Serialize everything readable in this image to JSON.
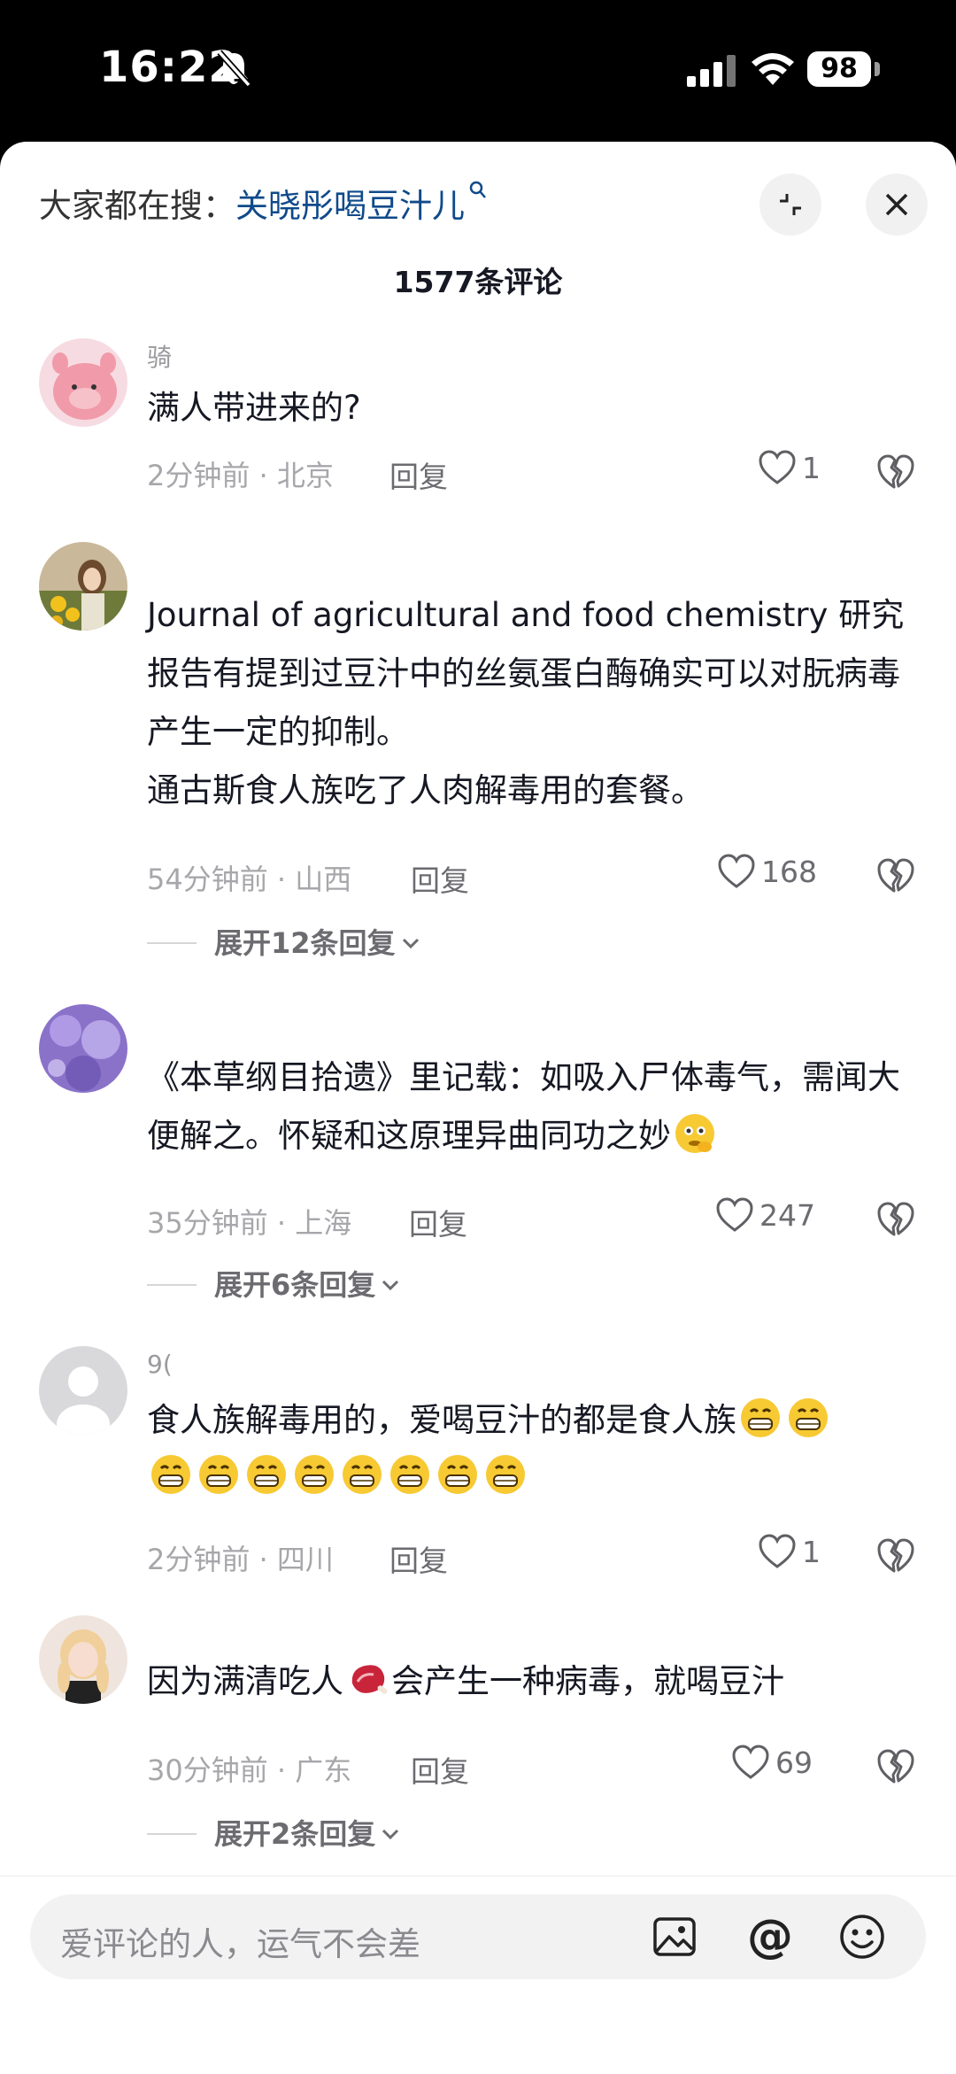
{
  "status": {
    "time": "16:22",
    "battery": "98"
  },
  "header": {
    "search_prefix": "大家都在搜：",
    "search_keyword": "关晓彤喝豆汁儿",
    "comment_count": "1577条评论"
  },
  "comments": [
    {
      "username": "骑",
      "text": "满人带进来的?",
      "meta": "2分钟前 · 北京",
      "reply": "回复",
      "likes": "1"
    },
    {
      "username": "",
      "text": "Journal of agricultural and food chemistry 研究报告有提到过豆汁中的丝氨蛋白酶确实可以对朊病毒产生一定的抑制。\n通古斯食人族吃了人肉解毒用的套餐。",
      "meta": "54分钟前 · 山西",
      "reply": "回复",
      "likes": "168",
      "expand": "展开12条回复"
    },
    {
      "username": "",
      "text": "《本草纲目拾遗》里记载：如吸入尸体毒气，需闻大便解之。怀疑和这原理异曲同功之妙",
      "meta": "35分钟前 · 上海",
      "reply": "回复",
      "likes": "247",
      "expand": "展开6条回复"
    },
    {
      "username": "9(",
      "text": "食人族解毒用的，爱喝豆汁的都是食人族",
      "meta": "2分钟前 · 四川",
      "reply": "回复",
      "likes": "1"
    },
    {
      "username": "",
      "text_a": "因为满清吃人",
      "text_b": "会产生一种病毒，就喝豆汁",
      "meta": "30分钟前 · 广东",
      "reply": "回复",
      "likes": "69",
      "expand": "展开2条回复"
    }
  ],
  "bottom": {
    "placeholder": "爱评论的人，运气不会差",
    "at_symbol": "@"
  },
  "icons": [
    "bell-slash-icon",
    "signal-icon",
    "wifi-icon",
    "search-icon",
    "collapse-icon",
    "close-icon",
    "heart-icon",
    "broken-heart-icon",
    "chevron-down-icon",
    "image-icon",
    "at-icon",
    "smile-icon"
  ],
  "colors": {
    "keyword": "#0f4a8a",
    "text": "#161823",
    "muted": "#a7a7ab"
  }
}
